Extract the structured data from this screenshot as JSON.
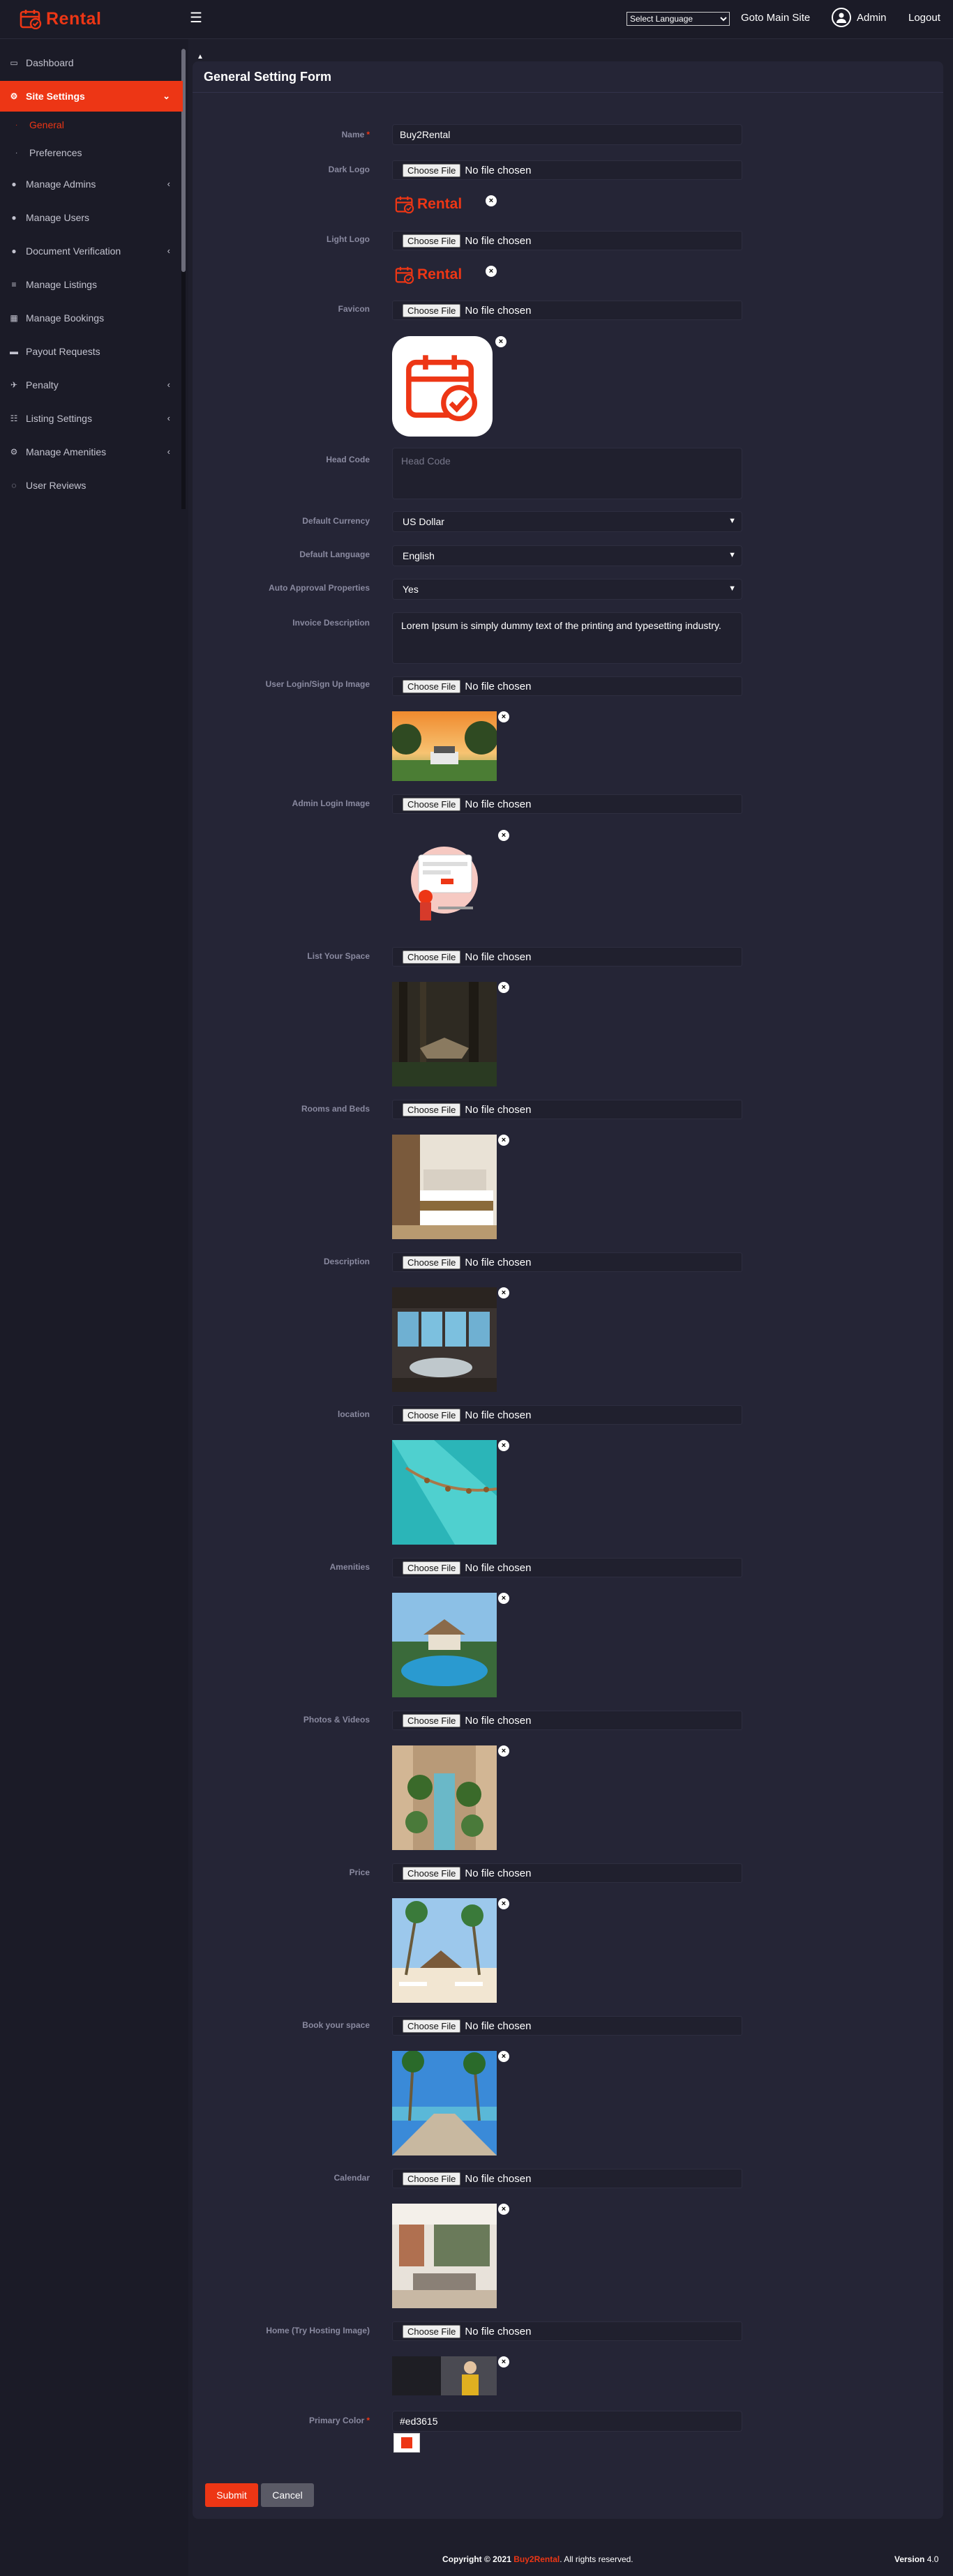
{
  "brand": {
    "logo_text": "Rental",
    "color": "#ed3615"
  },
  "header": {
    "language_select": "Select Language",
    "goto_main_site": "Goto Main Site",
    "admin_name": "Admin",
    "logout": "Logout"
  },
  "sidebar": {
    "items": [
      {
        "label": "Dashboard",
        "icon": "monitor-icon"
      },
      {
        "label": "Site Settings",
        "icon": "gear-icon"
      },
      {
        "label": "Manage Admins",
        "icon": "user-icon"
      },
      {
        "label": "Manage Users",
        "icon": "users-icon"
      },
      {
        "label": "Document Verification",
        "icon": "user-shield-icon"
      },
      {
        "label": "Manage Listings",
        "icon": "list-icon"
      },
      {
        "label": "Manage Bookings",
        "icon": "calendar-icon"
      },
      {
        "label": "Payout Requests",
        "icon": "card-icon"
      },
      {
        "label": "Penalty",
        "icon": "plane-icon"
      },
      {
        "label": "Listing Settings",
        "icon": "sliders-icon"
      },
      {
        "label": "Manage Amenities",
        "icon": "settings-icon"
      },
      {
        "label": "User Reviews",
        "icon": "comment-icon"
      }
    ],
    "sub_items": [
      {
        "label": "General"
      },
      {
        "label": "Preferences"
      }
    ]
  },
  "form": {
    "title": "General Setting Form",
    "choose_file": "Choose File",
    "no_file": "No file chosen",
    "name_label": "Name",
    "name_value": "Buy2Rental",
    "dark_logo_label": "Dark Logo",
    "light_logo_label": "Light Logo",
    "favicon_label": "Favicon",
    "head_code_label": "Head Code",
    "head_code_placeholder": "Head Code",
    "default_currency_label": "Default Currency",
    "default_currency_value": "US Dollar",
    "default_language_label": "Default Language",
    "default_language_value": "English",
    "auto_approval_label": "Auto Approval Properties",
    "auto_approval_value": "Yes",
    "invoice_description_label": "Invoice Description",
    "invoice_description_value": "Lorem Ipsum is simply dummy text of the printing and typesetting industry.",
    "user_login_image_label": "User Login/Sign Up Image",
    "admin_login_image_label": "Admin Login Image",
    "list_your_space_label": "List Your Space",
    "rooms_and_beds_label": "Rooms and Beds",
    "description_label": "Description",
    "location_label": "location",
    "amenities_label": "Amenities",
    "photos_videos_label": "Photos & Videos",
    "price_label": "Price",
    "book_your_space_label": "Book your space",
    "calendar_label": "Calendar",
    "home_try_hosting_label": "Home (Try Hosting Image)",
    "primary_color_label": "Primary Color",
    "primary_color_value": "#ed3615",
    "submit": "Submit",
    "cancel": "Cancel",
    "remove": "×"
  },
  "footer": {
    "copyright_prefix": "Copyright © 2021",
    "brand": "Buy2Rental",
    "suffix": ". All rights reserved.",
    "version_label": "Version",
    "version_value": "4.0"
  }
}
